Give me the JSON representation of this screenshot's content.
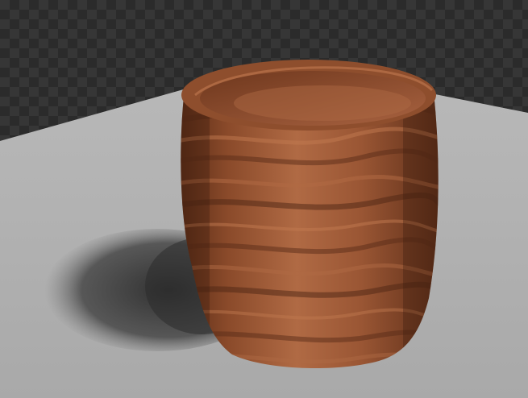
{
  "scene": {
    "subject": "wooden-cup-render",
    "colors": {
      "checker_dark": "#2b2b2b",
      "checker_light": "#363636",
      "floor": "#b3b3b3",
      "floor_shade": "#a6a6a6",
      "shadow": "#2a2a2a",
      "wood_dark": "#5a2c17",
      "wood_mid": "#8a4a2a",
      "wood_light": "#b06a44",
      "wood_highlight": "#c27a50",
      "inner_dark": "#4a2414"
    }
  }
}
